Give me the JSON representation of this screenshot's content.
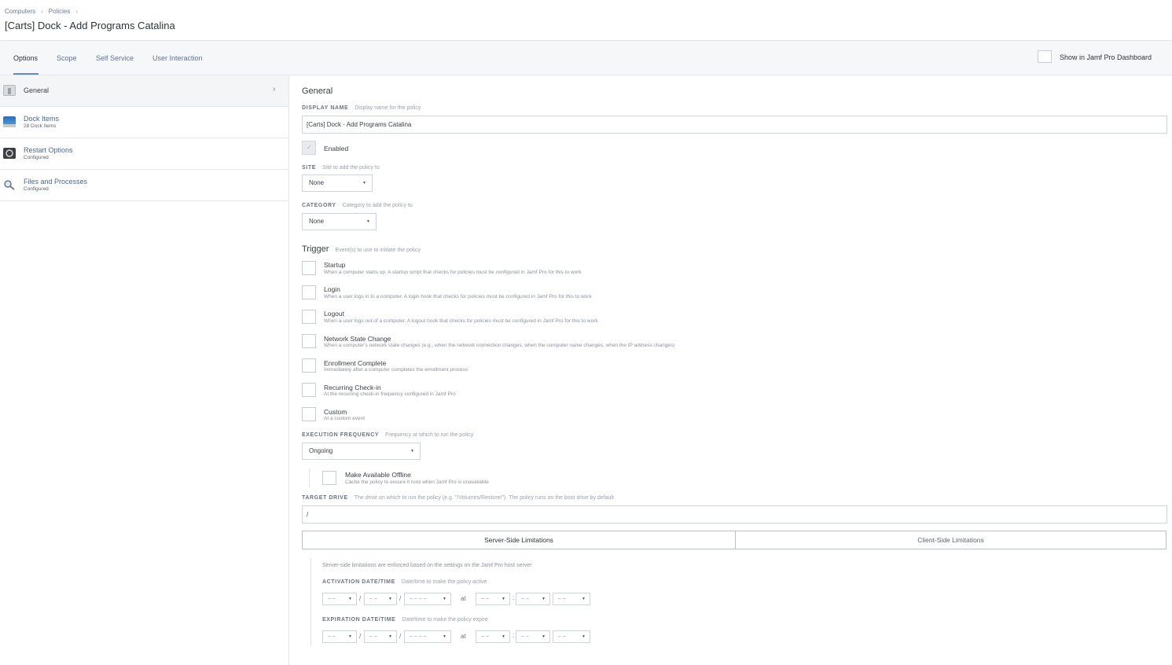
{
  "breadcrumb": {
    "items": [
      "Computers",
      "Policies"
    ],
    "separator": "›"
  },
  "page_title": "[Carts] Dock - Add Programs Catalina",
  "tabs": [
    "Options",
    "Scope",
    "Self Service",
    "User Interaction"
  ],
  "dashboard_toggle": {
    "label": "Show in Jamf Pro Dashboard"
  },
  "sidebar": {
    "items": [
      {
        "title": "General",
        "subtitle": "",
        "icon": "general-icon",
        "chevron": "›"
      },
      {
        "title": "Dock Items",
        "subtitle": "28 Dock Items",
        "icon": "dock-icon"
      },
      {
        "title": "Restart Options",
        "subtitle": "Configured",
        "icon": "restart-icon"
      },
      {
        "title": "Files and Processes",
        "subtitle": "Configured",
        "icon": "magnifier-icon"
      }
    ]
  },
  "general": {
    "section_title": "General",
    "display_name": {
      "label": "DISPLAY NAME",
      "hint": "Display name for the policy",
      "value": "[Carts] Dock - Add Programs Catalina"
    },
    "enabled": {
      "label": "Enabled",
      "checked": true
    },
    "site": {
      "label": "SITE",
      "hint": "Site to add the policy to",
      "value": "None"
    },
    "category": {
      "label": "CATEGORY",
      "hint": "Category to add the policy to",
      "value": "None"
    },
    "trigger": {
      "title": "Trigger",
      "hint": "Event(s) to use to initiate the policy",
      "items": [
        {
          "title": "Startup",
          "desc": "When a computer starts up. A startup script that checks for policies must be configured in Jamf Pro for this to work"
        },
        {
          "title": "Login",
          "desc": "When a user logs in to a computer. A login hook that checks for policies must be configured in Jamf Pro for this to work"
        },
        {
          "title": "Logout",
          "desc": "When a user logs out of a computer. A logout hook that checks for policies must be configured in Jamf Pro for this to work"
        },
        {
          "title": "Network State Change",
          "desc": "When a computer's network state changes (e.g., when the network connection changes, when the computer name changes, when the IP address changes)"
        },
        {
          "title": "Enrollment Complete",
          "desc": "Immediately after a computer completes the enrollment process"
        },
        {
          "title": "Recurring Check-in",
          "desc": "At the recurring check-in frequency configured in Jamf Pro"
        },
        {
          "title": "Custom",
          "desc": "At a custom event"
        }
      ]
    },
    "execution_frequency": {
      "label": "EXECUTION FREQUENCY",
      "hint": "Frequency at which to run the policy",
      "value": "Ongoing"
    },
    "offline": {
      "title": "Make Available Offline",
      "desc": "Cache the policy to ensure it runs when Jamf Pro is unavailable"
    },
    "target_drive": {
      "label": "TARGET DRIVE",
      "hint": "The drive on which to run the policy (e.g. \"/Volumes/Restore/\"). The policy runs on the boot drive by default",
      "value": "/"
    },
    "limitations": {
      "tabs": [
        "Server-Side Limitations",
        "Client-Side Limitations"
      ],
      "note": "Server-side limitations are enforced based on the settings on the Jamf Pro host server",
      "activation": {
        "label": "ACTIVATION DATE/TIME",
        "hint": "Date/time to make the policy active"
      },
      "expiration": {
        "label": "EXPIRATION DATE/TIME",
        "hint": "Date/time to make the policy expire"
      },
      "placeholders": {
        "mm": "– –",
        "dd": "– –",
        "yyyy": "– – – –",
        "hh": "– –",
        "min": "– –",
        "ampm": "– –"
      },
      "at": "at",
      "date_sep": "/",
      "time_sep": ":"
    }
  }
}
